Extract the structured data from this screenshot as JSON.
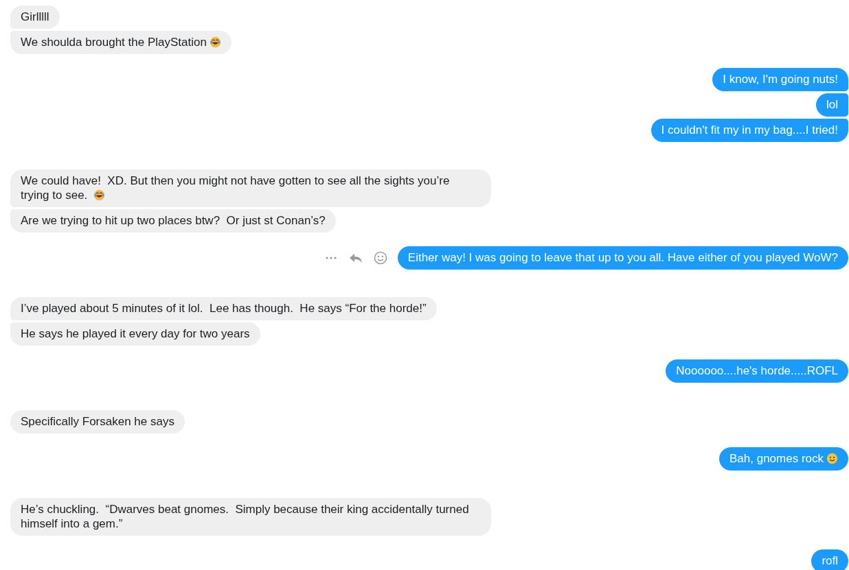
{
  "groups": [
    {
      "kind": "incoming",
      "messages": [
        {
          "kind": "plain",
          "text": "Girlllll",
          "hovered": false
        },
        {
          "kind": "laughing",
          "text": "We shoulda brought the PlayStation",
          "hovered": false
        }
      ]
    },
    {
      "kind": "outgoing",
      "messages": [
        {
          "kind": "plain",
          "text": "I know, I'm going nuts!",
          "hovered": false
        },
        {
          "kind": "plain",
          "text": "lol",
          "hovered": false
        },
        {
          "kind": "plain",
          "text": "I couldn't fit my in my bag....I tried!",
          "hovered": false
        }
      ]
    },
    {
      "kind": "incoming",
      "messages": [
        {
          "kind": "laughing",
          "text": "We could have!  XD. But then you might not have gotten to see all the sights you’re trying to see. ",
          "hovered": false
        },
        {
          "kind": "plain",
          "text": "Are we trying to hit up two places btw?  Or just st Conan’s?",
          "hovered": false
        }
      ]
    },
    {
      "kind": "outgoing",
      "messages": [
        {
          "kind": "plain",
          "text": "Either way! I was going to leave that up to you all. Have either of you played WoW?",
          "hovered": true
        }
      ]
    },
    {
      "kind": "incoming",
      "messages": [
        {
          "kind": "plain",
          "text": "I’ve played about 5 minutes of it lol.  Lee has though.  He says “For the horde!”",
          "hovered": false
        },
        {
          "kind": "plain",
          "text": "He says he played it every day for two years",
          "hovered": false
        }
      ]
    },
    {
      "kind": "outgoing",
      "messages": [
        {
          "kind": "plain",
          "text": "Noooooo....he's horde.....ROFL",
          "hovered": false
        }
      ]
    },
    {
      "kind": "incoming",
      "messages": [
        {
          "kind": "plain",
          "text": "Specifically Forsaken he says",
          "hovered": false
        }
      ]
    },
    {
      "kind": "outgoing",
      "messages": [
        {
          "kind": "smiling",
          "text": "Bah, gnomes rock",
          "hovered": false
        }
      ]
    },
    {
      "kind": "incoming",
      "messages": [
        {
          "kind": "plain",
          "text": "He’s chuckling.  “Dwarves beat gnomes.  Simply because their king accidentally turned himself into a gem.”",
          "hovered": false
        }
      ]
    },
    {
      "kind": "outgoing",
      "messages": [
        {
          "kind": "plain",
          "text": "rofl",
          "hovered": false
        }
      ]
    }
  ]
}
